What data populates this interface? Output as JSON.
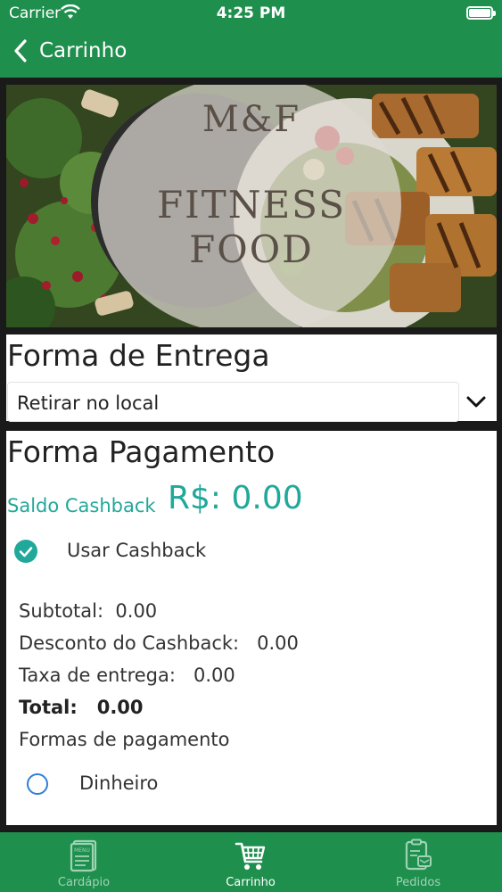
{
  "status_bar": {
    "carrier": "Carrier",
    "time": "4:25 PM"
  },
  "navbar": {
    "back_label": "Carrinho"
  },
  "banner": {
    "line1": "M&F",
    "line2": "FITNESS",
    "line3": "FOOD"
  },
  "delivery": {
    "title": "Forma de Entrega",
    "selected": "Retirar no local"
  },
  "payment": {
    "title": "Forma Pagamento",
    "cashback_label": "Saldo Cashback",
    "cashback_value": "R$: 0.00",
    "use_cashback": "Usar Cashback",
    "subtotal": "Subtotal:  0.00",
    "discount": "Desconto do Cashback:   0.00",
    "delivery_fee": "Taxa de entrega:   0.00",
    "total": "Total:   0.00",
    "methods_title": "Formas de pagamento",
    "method_cash": "Dinheiro"
  },
  "tabs": [
    {
      "label": "Cardápio",
      "icon": "menu-icon",
      "active": false
    },
    {
      "label": "Carrinho",
      "icon": "cart-icon",
      "active": true
    },
    {
      "label": "Pedidos",
      "icon": "orders-icon",
      "active": false
    }
  ],
  "colors": {
    "primary": "#1f8f4e",
    "accent": "#20a89a",
    "radio": "#2e7fd6"
  }
}
